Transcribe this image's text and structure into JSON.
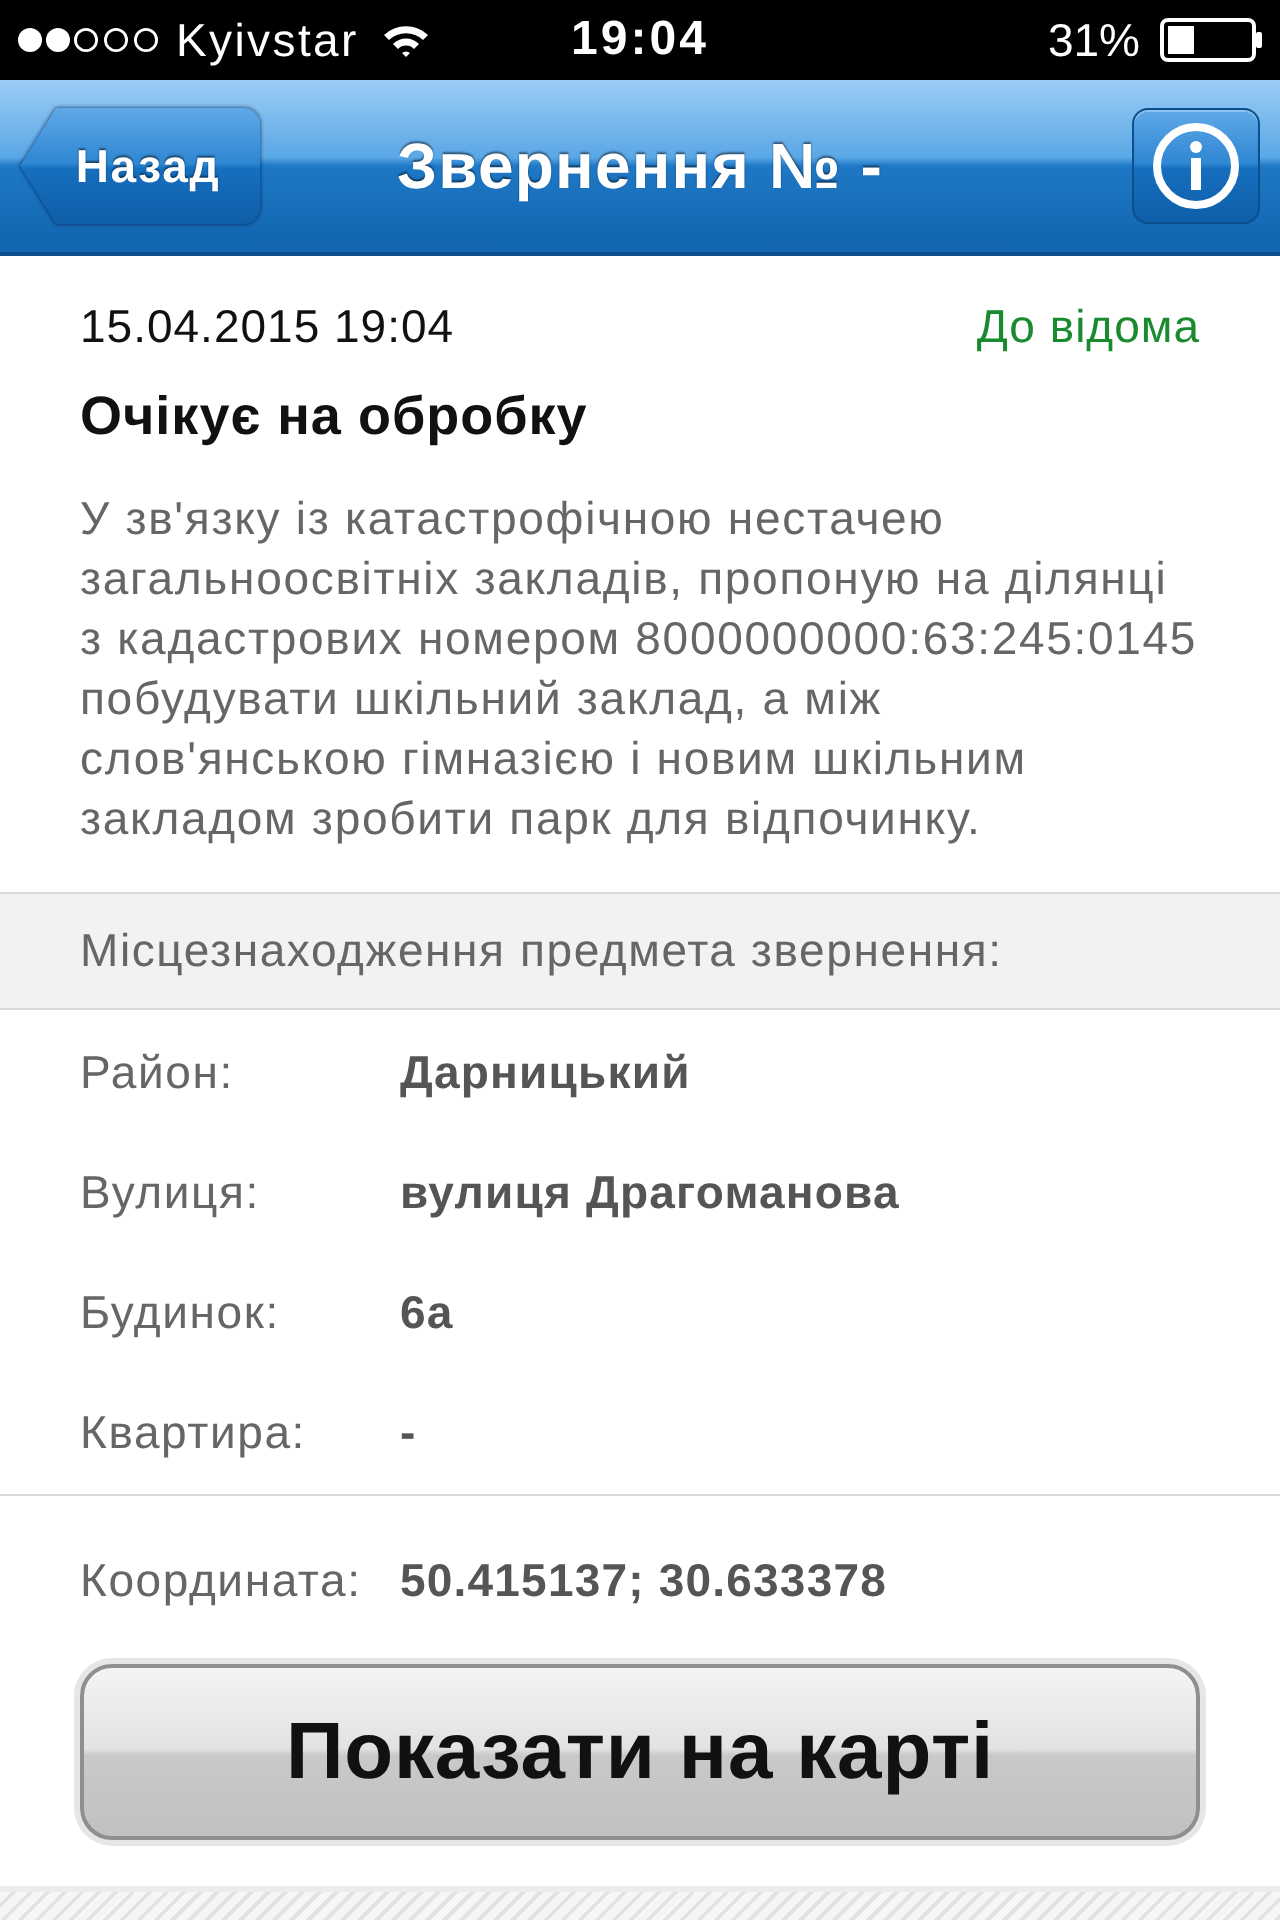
{
  "status_bar": {
    "carrier": "Kyivstar",
    "time": "19:04",
    "battery": "31%"
  },
  "nav_bar": {
    "back": "Назад",
    "title": "Звернення № -"
  },
  "appeal": {
    "date": "15.04.2015 19:04",
    "category": "До відома",
    "status": "Очікує на обробку",
    "description": "У зв'язку із катастрофічною нестачею загальноосвітніх закладів, пропоную на ділянці з кадастрових номером 8000000000:63:245:0145 побудувати шкільний заклад, а між слов'янською гімназією і новим шкільним закладом зробити парк для відпочинку."
  },
  "location": {
    "heading": "Місцезнаходження предмета звернення:",
    "fields": [
      {
        "label": "Район:",
        "value": "Дарницький"
      },
      {
        "label": "Вулиця:",
        "value": "вулиця Драгоманова"
      },
      {
        "label": "Будинок:",
        "value": "6а"
      },
      {
        "label": "Квартира:",
        "value": "-"
      }
    ]
  },
  "coordinates": {
    "label": "Координата:",
    "value": "50.415137; 30.633378"
  },
  "map_button": "Показати на карті"
}
